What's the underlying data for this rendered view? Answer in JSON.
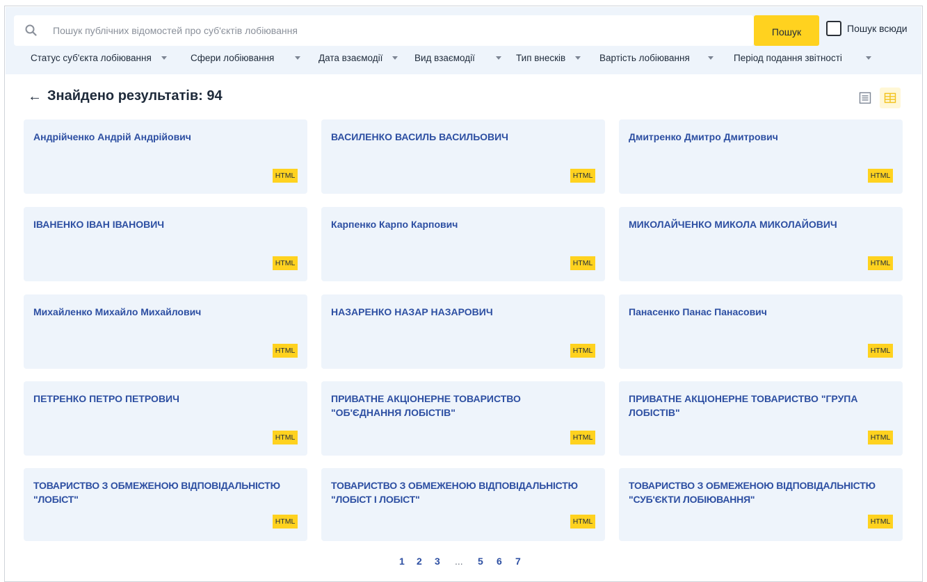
{
  "search": {
    "placeholder": "Пошук публічних відомостей про суб'єктів лобіювання",
    "value": "",
    "button_label": "Пошук",
    "everywhere_label": "Пошук всюди",
    "everywhere_checked": false
  },
  "filters": [
    "Статус суб'єкта лобіювання",
    "Сфери лобіювання",
    "Дата взаємодії",
    "Вид взаємодії",
    "Тип внесків",
    "Вартість лобіювання",
    "Період подання звітності"
  ],
  "results": {
    "back_arrow": "←",
    "title": "Знайдено результатів: 94"
  },
  "cards": [
    {
      "title": "Андрійченко Андрій Андрійович",
      "badge": "HTML"
    },
    {
      "title": "ВАСИЛЕНКО ВАСИЛЬ ВАСИЛЬОВИЧ",
      "badge": "HTML"
    },
    {
      "title": "Дмитренко Дмитро Дмитрович",
      "badge": "HTML"
    },
    {
      "title": "ІВАНЕНКО ІВАН ІВАНОВИЧ",
      "badge": "HTML"
    },
    {
      "title": "Карпенко Карпо Карпович",
      "badge": "HTML"
    },
    {
      "title": "МИКОЛАЙЧЕНКО МИКОЛА МИКОЛАЙОВИЧ",
      "badge": "HTML"
    },
    {
      "title": "Михайленко Михайло Михайлович",
      "badge": "HTML"
    },
    {
      "title": "НАЗАРЕНКО НАЗАР НАЗАРОВИЧ",
      "badge": "HTML"
    },
    {
      "title": "Панасенко Панас Панасович",
      "badge": "HTML"
    },
    {
      "title": "ПЕТРЕНКО ПЕТРО ПЕТРОВИЧ",
      "badge": "HTML"
    },
    {
      "title": "ПРИВАТНЕ АКЦІОНЕРНЕ ТОВАРИСТВО \"ОБ'ЄДНАННЯ ЛОБІСТІВ\"",
      "badge": "HTML"
    },
    {
      "title": "ПРИВАТНЕ АКЦІОНЕРНЕ ТОВАРИСТВО \"ГРУПА ЛОБІСТІВ\"",
      "badge": "HTML"
    },
    {
      "title": "ТОВАРИСТВО З ОБМЕЖЕНОЮ ВІДПОВІДАЛЬНІСТЮ \"ЛОБІСТ\"",
      "badge": "HTML"
    },
    {
      "title": "ТОВАРИСТВО З ОБМЕЖЕНОЮ ВІДПОВІДАЛЬНІСТЮ \"ЛОБІСТ І ЛОБІСТ\"",
      "badge": "HTML"
    },
    {
      "title": "ТОВАРИСТВО З ОБМЕЖЕНОЮ ВІДПОВІДАЛЬНІСТЮ \"СУБ'ЄКТИ ЛОБІЮВАННЯ\"",
      "badge": "HTML"
    }
  ],
  "pagination": [
    "1",
    "2",
    "3",
    "...",
    "5",
    "6",
    "7"
  ],
  "icons": {
    "search": "search-icon",
    "back": "arrow-left-icon",
    "list_view": "list-view-icon",
    "grid_view": "grid-view-icon",
    "dropdown": "chevron-down-icon"
  },
  "colors": {
    "accent_yellow": "#ffd21f",
    "panel_bg": "#eef4fb",
    "link_blue": "#2d4fa2",
    "text_dark": "#1e2a3a"
  }
}
